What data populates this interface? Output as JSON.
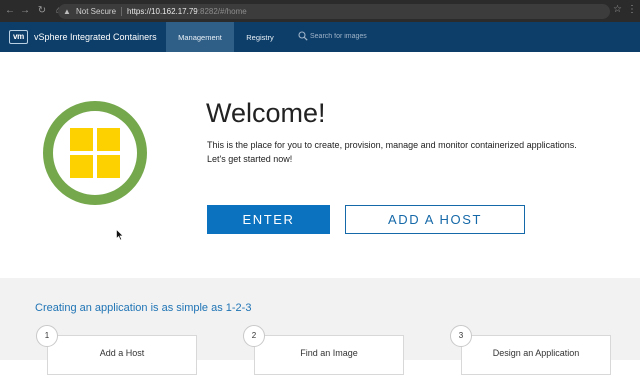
{
  "browser": {
    "security_label": "Not Secure",
    "url_host": "https://10.162.17.79",
    "url_rest": ":8282/#/home"
  },
  "header": {
    "logo_text": "vm",
    "app_title": "vSphere Integrated Containers",
    "tabs": [
      {
        "label": "Management",
        "active": true
      },
      {
        "label": "Registry",
        "active": false
      }
    ],
    "search_placeholder": "Search for images"
  },
  "hero": {
    "title": "Welcome!",
    "text_line1": "This is the place for you to create, provision, manage and monitor containerized applications.",
    "text_line2": "Let's get started now!",
    "enter_label": "ENTER",
    "add_host_label": "ADD A HOST"
  },
  "steps": {
    "heading": "Creating an application is as simple as 1-2-3",
    "items": [
      {
        "number": "1",
        "label": "Add a Host"
      },
      {
        "number": "2",
        "label": "Find an Image"
      },
      {
        "number": "3",
        "label": "Design an Application"
      }
    ]
  },
  "colors": {
    "header_bg": "#0d3e69",
    "active_tab_bg": "#2f5e86",
    "primary_button": "#0b72c0",
    "logo_ring": "#75a84c",
    "logo_squares": "#fdd100",
    "heading_blue": "#1f74b5"
  },
  "icons": [
    "back-icon",
    "forward-icon",
    "reload-icon",
    "home-icon",
    "warning-icon",
    "star-icon",
    "menu-icon",
    "search-icon",
    "vic-logo-icon",
    "cursor-icon"
  ]
}
